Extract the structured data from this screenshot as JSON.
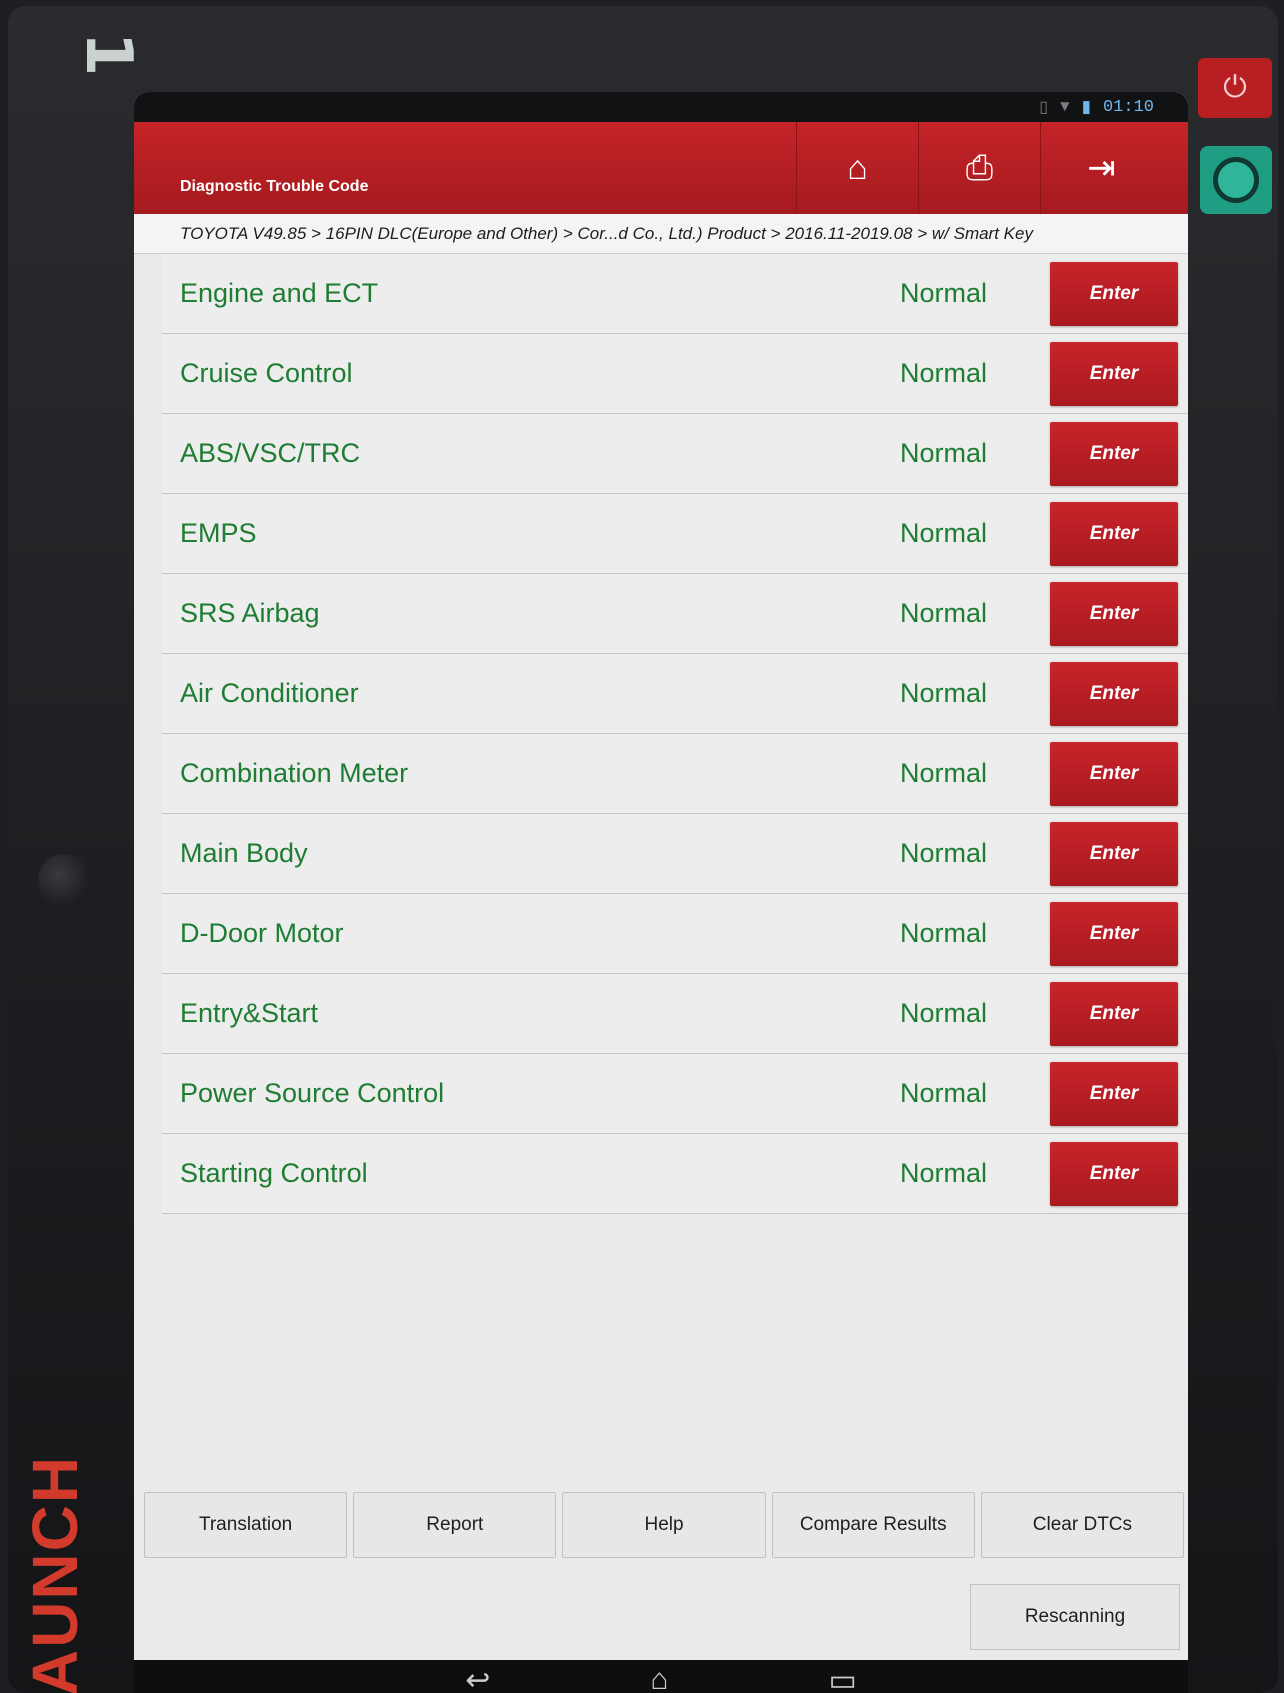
{
  "device": {
    "hw_number": "1",
    "brand": "AUNCH"
  },
  "statusbar": {
    "time": "01:10",
    "icons": [
      "sim-icon",
      "wifi-icon",
      "battery-icon"
    ]
  },
  "header": {
    "title": "Diagnostic Trouble Code",
    "buttons": [
      {
        "icon": "home-icon",
        "glyph": "⌂"
      },
      {
        "icon": "print-icon",
        "glyph": "⎙"
      },
      {
        "icon": "exit-icon",
        "glyph": "⇥"
      }
    ]
  },
  "breadcrumb": "TOYOTA V49.85 > 16PIN DLC(Europe and Other) > Cor...d Co., Ltd.) Product > 2016.11-2019.08 > w/ Smart Key",
  "systems": [
    {
      "name": "Engine and ECT",
      "status": "Normal",
      "button": "Enter"
    },
    {
      "name": "Cruise Control",
      "status": "Normal",
      "button": "Enter"
    },
    {
      "name": "ABS/VSC/TRC",
      "status": "Normal",
      "button": "Enter"
    },
    {
      "name": "EMPS",
      "status": "Normal",
      "button": "Enter"
    },
    {
      "name": "SRS Airbag",
      "status": "Normal",
      "button": "Enter"
    },
    {
      "name": "Air Conditioner",
      "status": "Normal",
      "button": "Enter"
    },
    {
      "name": "Combination Meter",
      "status": "Normal",
      "button": "Enter"
    },
    {
      "name": "Main Body",
      "status": "Normal",
      "button": "Enter"
    },
    {
      "name": "D-Door Motor",
      "status": "Normal",
      "button": "Enter"
    },
    {
      "name": "Entry&Start",
      "status": "Normal",
      "button": "Enter"
    },
    {
      "name": "Power Source Control",
      "status": "Normal",
      "button": "Enter"
    },
    {
      "name": "Starting Control",
      "status": "Normal",
      "button": "Enter"
    }
  ],
  "footer": {
    "translation": "Translation",
    "report": "Report",
    "help": "Help",
    "compare": "Compare Results",
    "clear": "Clear DTCs",
    "rescan": "Rescanning"
  },
  "colors": {
    "accent_red": "#b81f22",
    "status_green": "#1e7d33"
  }
}
